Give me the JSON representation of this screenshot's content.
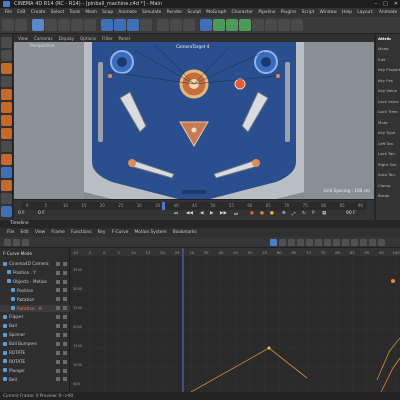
{
  "window": {
    "title": "CINEMA 4D R14 (RC - R14) - [pinball_machine.c4d *] - Main",
    "controls": [
      "–",
      "□",
      "✕"
    ]
  },
  "menu": [
    "File",
    "Edit",
    "Create",
    "Select",
    "Tools",
    "Mesh",
    "Snap",
    "Animate",
    "Simulate",
    "Render",
    "Sculpt",
    "MoGraph",
    "Character",
    "Pipeline",
    "Plugins",
    "Script",
    "Window",
    "Help",
    "Layout:",
    "Animate"
  ],
  "viewport": {
    "menu": [
      "View",
      "Cameras",
      "Display",
      "Options",
      "Filter",
      "Panel"
    ],
    "title": "Perspective",
    "camera_label": "CameraTarget 4",
    "grid_label": "Grid Spacing : 100 cm"
  },
  "timeline": {
    "ticks": [
      "0",
      "5",
      "10",
      "15",
      "20",
      "25",
      "30",
      "35",
      "40",
      "45",
      "50",
      "55",
      "60",
      "65",
      "70",
      "75",
      "80",
      "85",
      "90"
    ],
    "current_frame": "0 F",
    "start_field": "0 F",
    "end_field": "90 F",
    "playhead_frame": 37
  },
  "attributes": {
    "header": "Attrib",
    "rows": [
      "Mode",
      "Edit",
      "Key Properties",
      "Key Pos",
      "Key Value",
      "Lock Value",
      "Lock Time",
      "Mute",
      "Key Type",
      "Left Tan.",
      "Lock Tan.",
      "Right Tan.",
      "Auto Tan.",
      "Clamp",
      "Break"
    ]
  },
  "timeline_window": {
    "title": "Timeline",
    "menu": [
      "File",
      "Edit",
      "View",
      "Frame",
      "Functions",
      "Key",
      "F-Curve",
      "Motion System",
      "Bookmarks"
    ],
    "list_header": "F-Curve Mode",
    "objects": [
      {
        "name": "Cinema4D Camera",
        "indent": 0
      },
      {
        "name": "Position . Y",
        "indent": 1
      },
      {
        "name": "Objects - Motion",
        "indent": 1
      },
      {
        "name": "Position",
        "indent": 2
      },
      {
        "name": "Rotation",
        "indent": 2
      },
      {
        "name": "Rotation . H",
        "indent": 2,
        "highlight": true
      },
      {
        "name": "Flipper",
        "indent": 0
      },
      {
        "name": "Ball",
        "indent": 0
      },
      {
        "name": "Spinner",
        "indent": 0
      },
      {
        "name": "Ball Bumpers",
        "indent": 0
      },
      {
        "name": "ROTATE",
        "indent": 0
      },
      {
        "name": "ROTATE",
        "indent": 0
      },
      {
        "name": "Plunger",
        "indent": 0
      },
      {
        "name": "Bell",
        "indent": 0
      }
    ],
    "frame_ticks": [
      "-10",
      "-5",
      "0",
      "5",
      "10",
      "15",
      "20",
      "25",
      "30",
      "35",
      "40",
      "45",
      "50",
      "55",
      "60",
      "65",
      "70",
      "75",
      "80",
      "85",
      "90",
      "95",
      "100"
    ],
    "value_labels": [
      "3500",
      "3000",
      "2500",
      "2000",
      "1500",
      "1000",
      "500"
    ],
    "curve_color": "#c8903e",
    "playhead_color": "#4a7bd0"
  },
  "status": "Current Frame: 0   Preview: 0-->90",
  "colors": {
    "board_blue": "#2b4f8e",
    "accent_orange": "#e8843e",
    "ui_blue": "#4a7bd0"
  }
}
